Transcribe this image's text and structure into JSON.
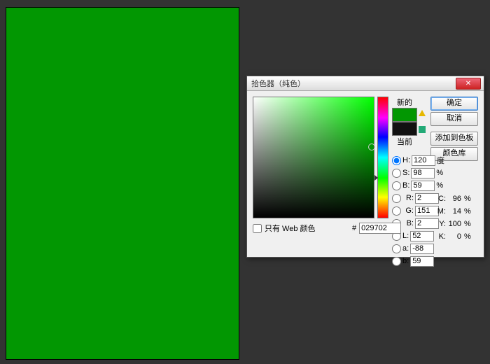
{
  "canvas": {
    "fill": "#029702"
  },
  "dialog": {
    "title": "拾色器（纯色）",
    "buttons": {
      "ok": "确定",
      "cancel": "取消",
      "add": "添加到色板",
      "library": "颜色库"
    },
    "labels": {
      "new": "新的",
      "current": "当前",
      "webonly": "只有 Web 颜色",
      "hash": "#"
    },
    "swatch": {
      "new": "#029702",
      "current": "#111111"
    },
    "hsb": {
      "H": {
        "label": "H:",
        "value": "120",
        "unit": "度"
      },
      "S": {
        "label": "S:",
        "value": "98",
        "unit": "%"
      },
      "B": {
        "label": "B:",
        "value": "59",
        "unit": "%"
      }
    },
    "lab": {
      "L": {
        "label": "L:",
        "value": "52"
      },
      "a": {
        "label": "a:",
        "value": "-88"
      },
      "b": {
        "label": "b:",
        "value": "59"
      }
    },
    "rgb": {
      "R": {
        "label": "R:",
        "value": "2"
      },
      "G": {
        "label": "G:",
        "value": "151"
      },
      "B": {
        "label": "B:",
        "value": "2"
      }
    },
    "cmyk": {
      "C": {
        "label": "C:",
        "value": "96",
        "unit": "%"
      },
      "M": {
        "label": "M:",
        "value": "14",
        "unit": "%"
      },
      "Y": {
        "label": "Y:",
        "value": "100",
        "unit": "%"
      },
      "K": {
        "label": "K:",
        "value": "0",
        "unit": "%"
      }
    },
    "hex": "029702",
    "selectedModel": "H"
  }
}
